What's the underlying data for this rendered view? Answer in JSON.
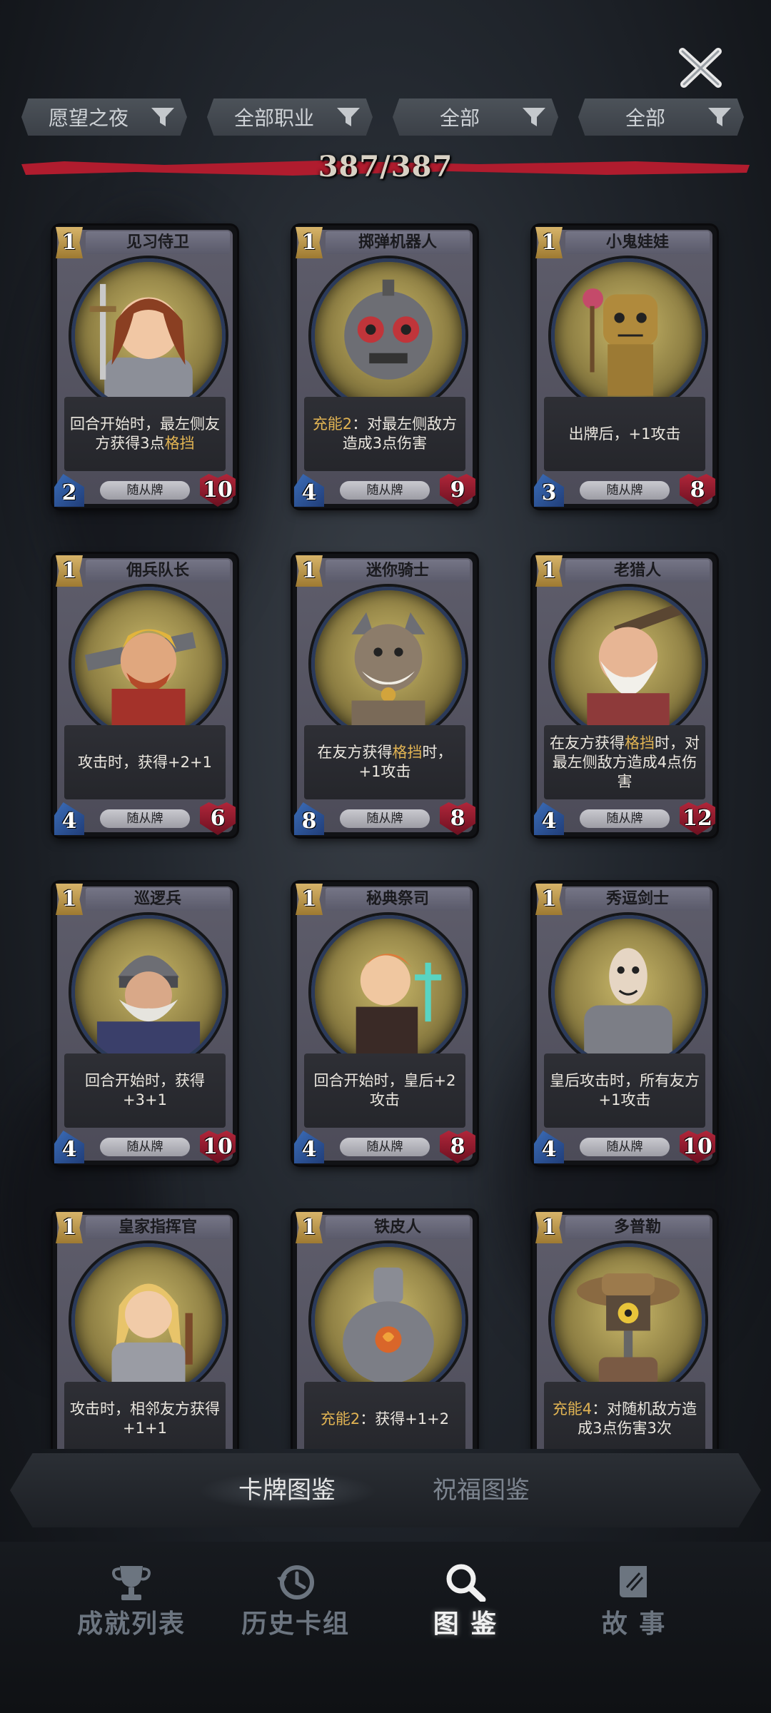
{
  "close_label": "✕",
  "filters": [
    {
      "label": "愿望之夜"
    },
    {
      "label": "全部职业"
    },
    {
      "label": "全部"
    },
    {
      "label": "全部"
    }
  ],
  "counter": "387/387",
  "cards": [
    {
      "name": "见习侍卫",
      "cost": "1",
      "attack": "2",
      "health": "10",
      "type": "随从牌",
      "text": [
        {
          "t": "回合开始时，最左侧友方获得3点"
        },
        {
          "t": "格挡",
          "hl": true
        }
      ],
      "portrait": "knight-girl"
    },
    {
      "name": "掷弹机器人",
      "cost": "1",
      "attack": "4",
      "health": "9",
      "type": "随从牌",
      "text": [
        {
          "t": "充能2",
          "hl": true
        },
        {
          "t": "：对最左侧敌方造成3点伤害"
        }
      ],
      "portrait": "bomb-robot"
    },
    {
      "name": "小鬼娃娃",
      "cost": "1",
      "attack": "3",
      "health": "8",
      "type": "随从牌",
      "text": [
        {
          "t": "出牌后，+1攻击"
        }
      ],
      "portrait": "voodoo-doll"
    },
    {
      "name": "佣兵队长",
      "cost": "1",
      "attack": "4",
      "health": "6",
      "type": "随从牌",
      "text": [
        {
          "t": "攻击时，获得+2+1"
        }
      ],
      "portrait": "mercenary"
    },
    {
      "name": "迷你骑士",
      "cost": "1",
      "attack": "8",
      "health": "8",
      "type": "随从牌",
      "text": [
        {
          "t": "在友方获得"
        },
        {
          "t": "格挡",
          "hl": true
        },
        {
          "t": "时，+1攻击"
        }
      ],
      "portrait": "mini-knight"
    },
    {
      "name": "老猎人",
      "cost": "1",
      "attack": "4",
      "health": "12",
      "type": "随从牌",
      "text": [
        {
          "t": "在友方获得"
        },
        {
          "t": "格挡",
          "hl": true
        },
        {
          "t": "时，对最左侧敌方造成4点伤害"
        }
      ],
      "portrait": "old-hunter"
    },
    {
      "name": "巡逻兵",
      "cost": "1",
      "attack": "4",
      "health": "10",
      "type": "随从牌",
      "text": [
        {
          "t": "回合开始时，获得+3+1"
        }
      ],
      "portrait": "patrol"
    },
    {
      "name": "秘典祭司",
      "cost": "1",
      "attack": "4",
      "health": "8",
      "type": "随从牌",
      "text": [
        {
          "t": "回合开始时，皇后+2攻击"
        }
      ],
      "portrait": "priest"
    },
    {
      "name": "秀逗剑士",
      "cost": "1",
      "attack": "4",
      "health": "10",
      "type": "随从牌",
      "text": [
        {
          "t": "皇后攻击时，所有友方+1攻击"
        }
      ],
      "portrait": "swordsman"
    },
    {
      "name": "皇家指挥官",
      "cost": "1",
      "attack": "",
      "health": "",
      "type": "",
      "text": [
        {
          "t": "攻击时，相邻友方获得+1+1"
        }
      ],
      "portrait": "commander"
    },
    {
      "name": "铁皮人",
      "cost": "1",
      "attack": "",
      "health": "",
      "type": "",
      "text": [
        {
          "t": "充能2",
          "hl": true
        },
        {
          "t": "：获得+1+2"
        }
      ],
      "portrait": "tin-man"
    },
    {
      "name": "多普勒",
      "cost": "1",
      "attack": "",
      "health": "",
      "type": "",
      "text": [
        {
          "t": "充能4",
          "hl": true
        },
        {
          "t": "：对随机敌方造成3点伤害3次"
        }
      ],
      "portrait": "doppler"
    }
  ],
  "subtabs": {
    "active": "卡牌图鉴",
    "inactive": "祝福图鉴"
  },
  "nav": [
    {
      "label": "成就列表",
      "icon": "trophy-icon",
      "active": false
    },
    {
      "label": "历史卡组",
      "icon": "history-icon",
      "active": false
    },
    {
      "label": "图 鉴",
      "icon": "magnifier-icon",
      "active": true
    },
    {
      "label": "故 事",
      "icon": "book-icon",
      "active": false
    }
  ],
  "colors": {
    "accent_gold": "#e2b453",
    "banner_red": "#b01c2e",
    "attack_blue": "#2f5fa8",
    "health_red": "#9c1a2c"
  }
}
